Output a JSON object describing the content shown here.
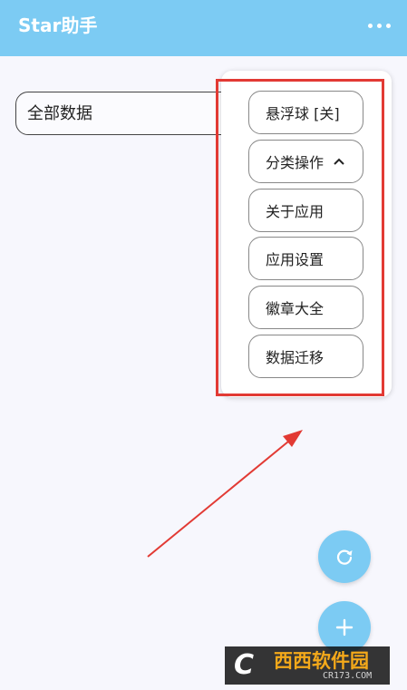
{
  "app": {
    "title": "Star助手"
  },
  "filter": {
    "label": "全部数据"
  },
  "menu": {
    "items": [
      {
        "label": "悬浮球 [关]"
      },
      {
        "label": "分类操作"
      },
      {
        "label": "关于应用"
      },
      {
        "label": "应用设置"
      },
      {
        "label": "徽章大全"
      },
      {
        "label": "数据迁移"
      }
    ]
  },
  "icons": {
    "more": "more-horizontal-icon",
    "expand": "chevron-up-icon",
    "refresh": "refresh-icon",
    "add": "plus-icon"
  },
  "watermark": {
    "logo_text": "西西软件园",
    "site": "CR173.COM"
  },
  "colors": {
    "header": "#7ccbf3",
    "highlight": "#e23a34",
    "background": "#f7f7fd"
  }
}
